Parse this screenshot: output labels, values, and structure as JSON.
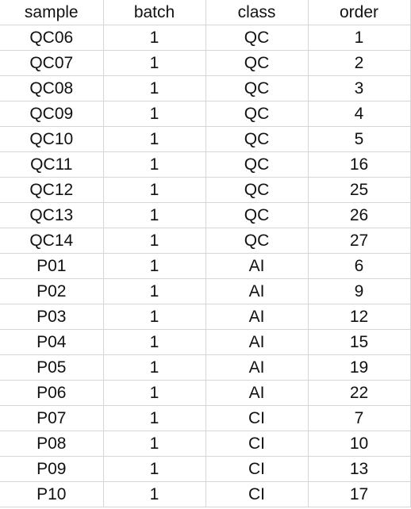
{
  "sheet": {
    "columns": [
      "sample",
      "batch",
      "class",
      "order"
    ],
    "rows": [
      [
        "QC06",
        "1",
        "QC",
        "1"
      ],
      [
        "QC07",
        "1",
        "QC",
        "2"
      ],
      [
        "QC08",
        "1",
        "QC",
        "3"
      ],
      [
        "QC09",
        "1",
        "QC",
        "4"
      ],
      [
        "QC10",
        "1",
        "QC",
        "5"
      ],
      [
        "QC11",
        "1",
        "QC",
        "16"
      ],
      [
        "QC12",
        "1",
        "QC",
        "25"
      ],
      [
        "QC13",
        "1",
        "QC",
        "26"
      ],
      [
        "QC14",
        "1",
        "QC",
        "27"
      ],
      [
        "P01",
        "1",
        "AI",
        "6"
      ],
      [
        "P02",
        "1",
        "AI",
        "9"
      ],
      [
        "P03",
        "1",
        "AI",
        "12"
      ],
      [
        "P04",
        "1",
        "AI",
        "15"
      ],
      [
        "P05",
        "1",
        "AI",
        "19"
      ],
      [
        "P06",
        "1",
        "AI",
        "22"
      ],
      [
        "P07",
        "1",
        "CI",
        "7"
      ],
      [
        "P08",
        "1",
        "CI",
        "10"
      ],
      [
        "P09",
        "1",
        "CI",
        "13"
      ],
      [
        "P10",
        "1",
        "CI",
        "17"
      ]
    ]
  }
}
